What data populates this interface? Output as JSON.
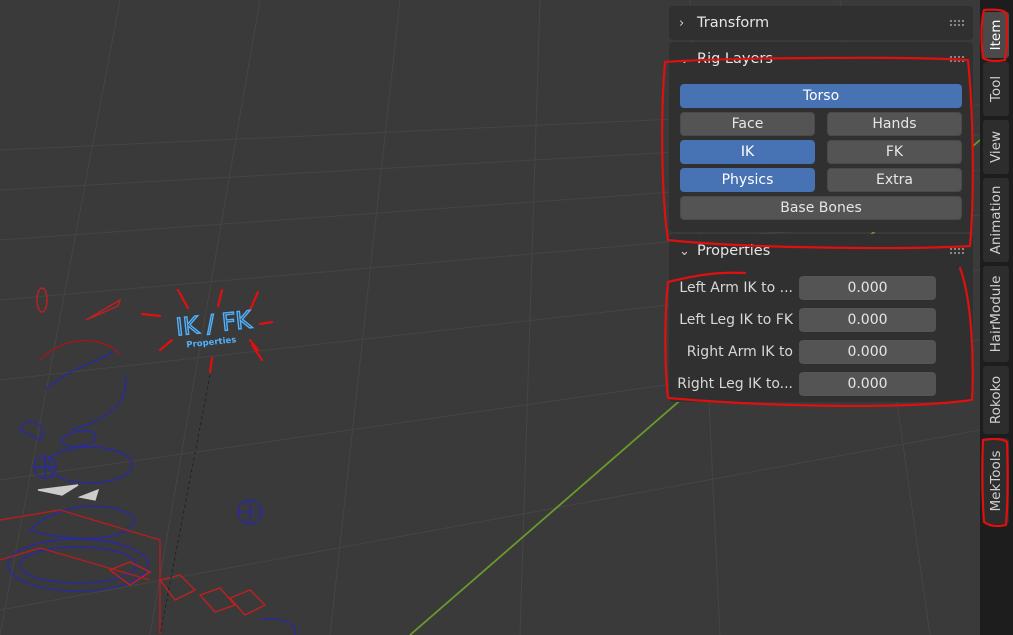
{
  "viewport": {
    "annotation_title": "IK / FK",
    "annotation_subtitle": "Properties"
  },
  "npanel": {
    "transform": {
      "title": "Transform",
      "collapsed": true
    },
    "rig_layers": {
      "title": "Rig Layers",
      "buttons": [
        {
          "label": "Torso",
          "active": true
        },
        {
          "label": "Face",
          "active": false
        },
        {
          "label": "Hands",
          "active": false
        },
        {
          "label": "IK",
          "active": true
        },
        {
          "label": "FK",
          "active": false
        },
        {
          "label": "Physics",
          "active": true
        },
        {
          "label": "Extra",
          "active": false
        },
        {
          "label": "Base Bones",
          "active": false
        }
      ]
    },
    "properties": {
      "title": "Properties",
      "rows": [
        {
          "label": "Left Arm IK to ...",
          "value": "0.000"
        },
        {
          "label": "Left Leg IK to FK",
          "value": "0.000"
        },
        {
          "label": "Right Arm IK to",
          "value": "0.000"
        },
        {
          "label": "Right Leg IK to...",
          "value": "0.000"
        }
      ]
    }
  },
  "tabs": [
    {
      "label": "Item",
      "active": true
    },
    {
      "label": "Tool",
      "active": false
    },
    {
      "label": "View",
      "active": false
    },
    {
      "label": "Animation",
      "active": false
    },
    {
      "label": "HairModule",
      "active": false
    },
    {
      "label": "Rokoko",
      "active": false
    },
    {
      "label": "MekTools",
      "active": false
    }
  ],
  "colors": {
    "accent": "#4772b3",
    "annotation": "#e01010",
    "viewport_bg": "#3a3a3a",
    "panel_bg": "#303030"
  },
  "icons": {
    "collapsed": "chevron-right-icon",
    "expanded": "chevron-down-icon",
    "drag": "grip-icon"
  }
}
